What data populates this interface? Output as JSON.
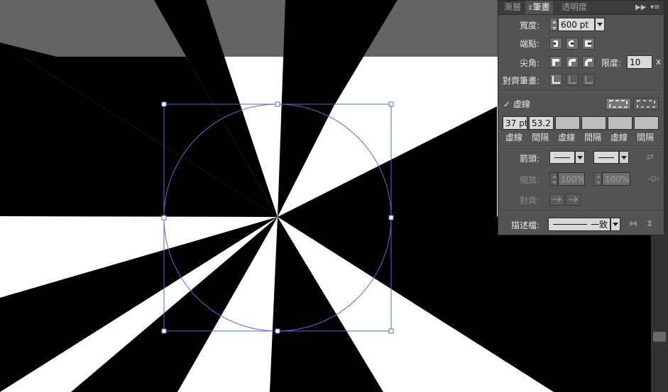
{
  "panel": {
    "tabs": [
      {
        "label": "漸層",
        "active": false
      },
      {
        "label": "筆畫",
        "active": true,
        "prefix_icon": "expand-arrows-icon"
      },
      {
        "label": "透明度",
        "active": false
      }
    ],
    "collapse_icon": "double-chevron-right-icon",
    "menu_icon": "panel-menu-icon",
    "weight": {
      "label": "寬度:",
      "value": "600 pt"
    },
    "cap": {
      "label": "端點:",
      "options": [
        "butt-cap-icon",
        "round-cap-icon",
        "projecting-cap-icon"
      ]
    },
    "corner": {
      "label": "尖角:",
      "options": [
        "miter-join-icon",
        "round-join-icon",
        "bevel-join-icon"
      ],
      "limit_label": "限度:",
      "limit_value": "10",
      "limit_unit": "x"
    },
    "align": {
      "label": "對齊筆畫:",
      "options": [
        "align-center-icon",
        "align-inside-icon",
        "align-outside-icon"
      ]
    },
    "dashed": {
      "label": "虛線",
      "checked": true,
      "mode_icons": [
        "dash-preserve-icon",
        "dash-align-corners-icon"
      ]
    },
    "dash_fields": [
      {
        "value": "37 pt",
        "label": "虛線"
      },
      {
        "value": "53.2",
        "label": "間隔"
      },
      {
        "value": "",
        "label": "虛線"
      },
      {
        "value": "",
        "label": "間隔"
      },
      {
        "value": "",
        "label": "虛線"
      },
      {
        "value": "",
        "label": "間隔"
      }
    ],
    "arrowheads": {
      "label": "箭頭:",
      "swap_icon": "swap-arrows-icon"
    },
    "scale": {
      "label": "縮放:",
      "value1": "100%",
      "value2": "100%",
      "link_icon": "link-scale-icon"
    },
    "arrow_align": {
      "label": "對齊:",
      "icons": [
        "arrow-tip-beyond-icon",
        "arrow-tip-at-end-icon"
      ]
    },
    "profile": {
      "label": "描述檔:",
      "value": "一致",
      "flip_icons": [
        "flip-horizontal-icon",
        "flip-vertical-icon"
      ]
    }
  },
  "colors": {
    "panel_bg": "#535353",
    "tab_bg": "#3c3c3c",
    "selection": "#4f6fd6",
    "artwork_black": "#000000",
    "artwork_white": "#ffffff",
    "artwork_gray": "#646464"
  }
}
